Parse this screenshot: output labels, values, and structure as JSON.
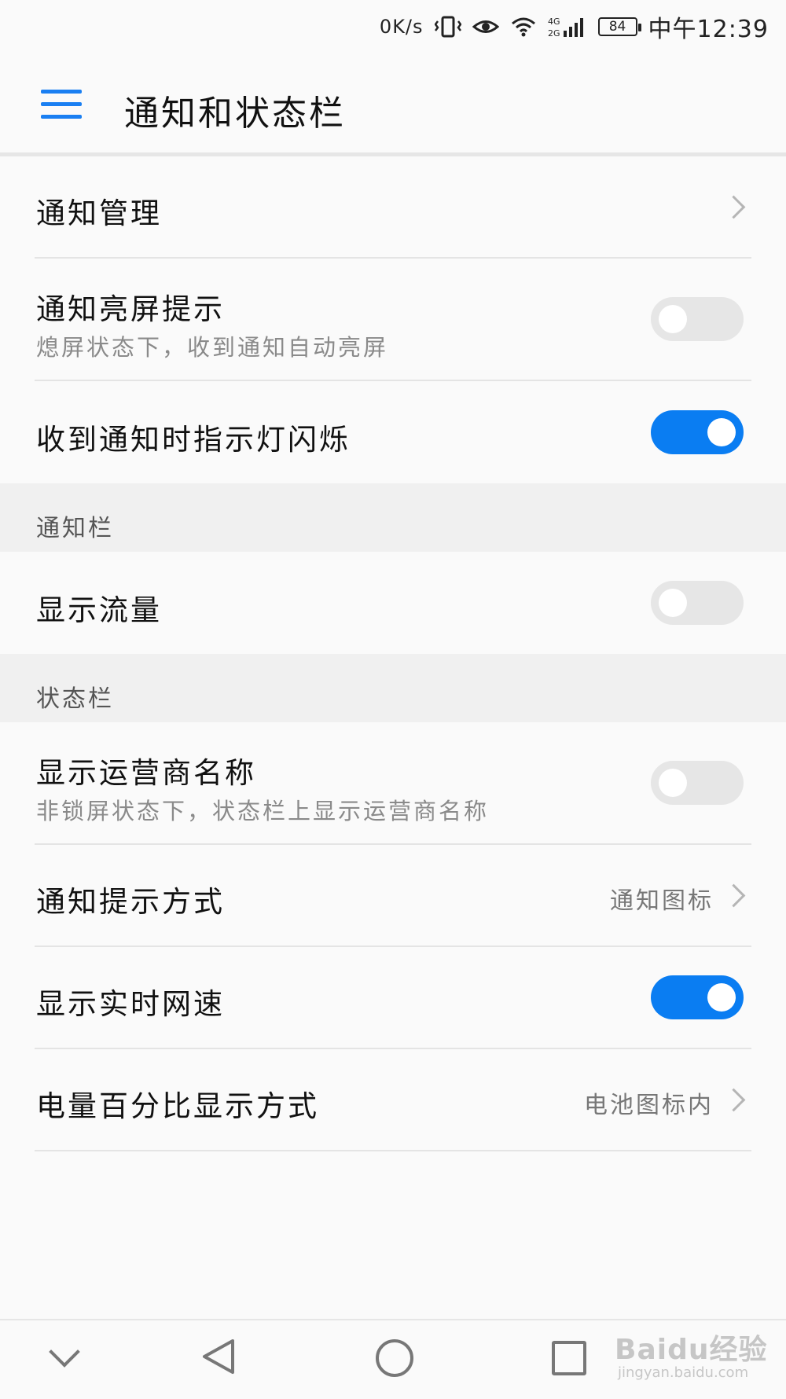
{
  "status_bar": {
    "net_speed": "0K/s",
    "network_type": "4G 2G",
    "battery_level": "84",
    "time": "中午12:39",
    "icons": [
      "vibrate-icon",
      "eye-comfort-icon",
      "wifi-icon",
      "signal-icon",
      "battery-icon"
    ]
  },
  "header": {
    "title": "通知和状态栏"
  },
  "settings": {
    "notification_management": {
      "label": "通知管理"
    },
    "wake_screen": {
      "label": "通知亮屏提示",
      "sub": "熄屏状态下，收到通知自动亮屏",
      "enabled": false
    },
    "led_blink": {
      "label": "收到通知时指示灯闪烁",
      "enabled": true
    }
  },
  "section_notification_bar": {
    "header": "通知栏",
    "show_traffic": {
      "label": "显示流量",
      "enabled": false
    }
  },
  "section_status_bar": {
    "header": "状态栏",
    "carrier_name": {
      "label": "显示运营商名称",
      "sub": "非锁屏状态下，状态栏上显示运营商名称",
      "enabled": false
    },
    "notify_style": {
      "label": "通知提示方式",
      "value": "通知图标"
    },
    "realtime_speed": {
      "label": "显示实时网速",
      "enabled": true
    },
    "battery_percent": {
      "label": "电量百分比显示方式",
      "value": "电池图标内"
    }
  },
  "colors": {
    "accent": "#0a7df2",
    "toggle_off": "#e6e6e6",
    "section_bg": "#f0f0f0"
  },
  "watermark": {
    "logo": "Baidu经验",
    "url": "jingyan.baidu.com"
  }
}
